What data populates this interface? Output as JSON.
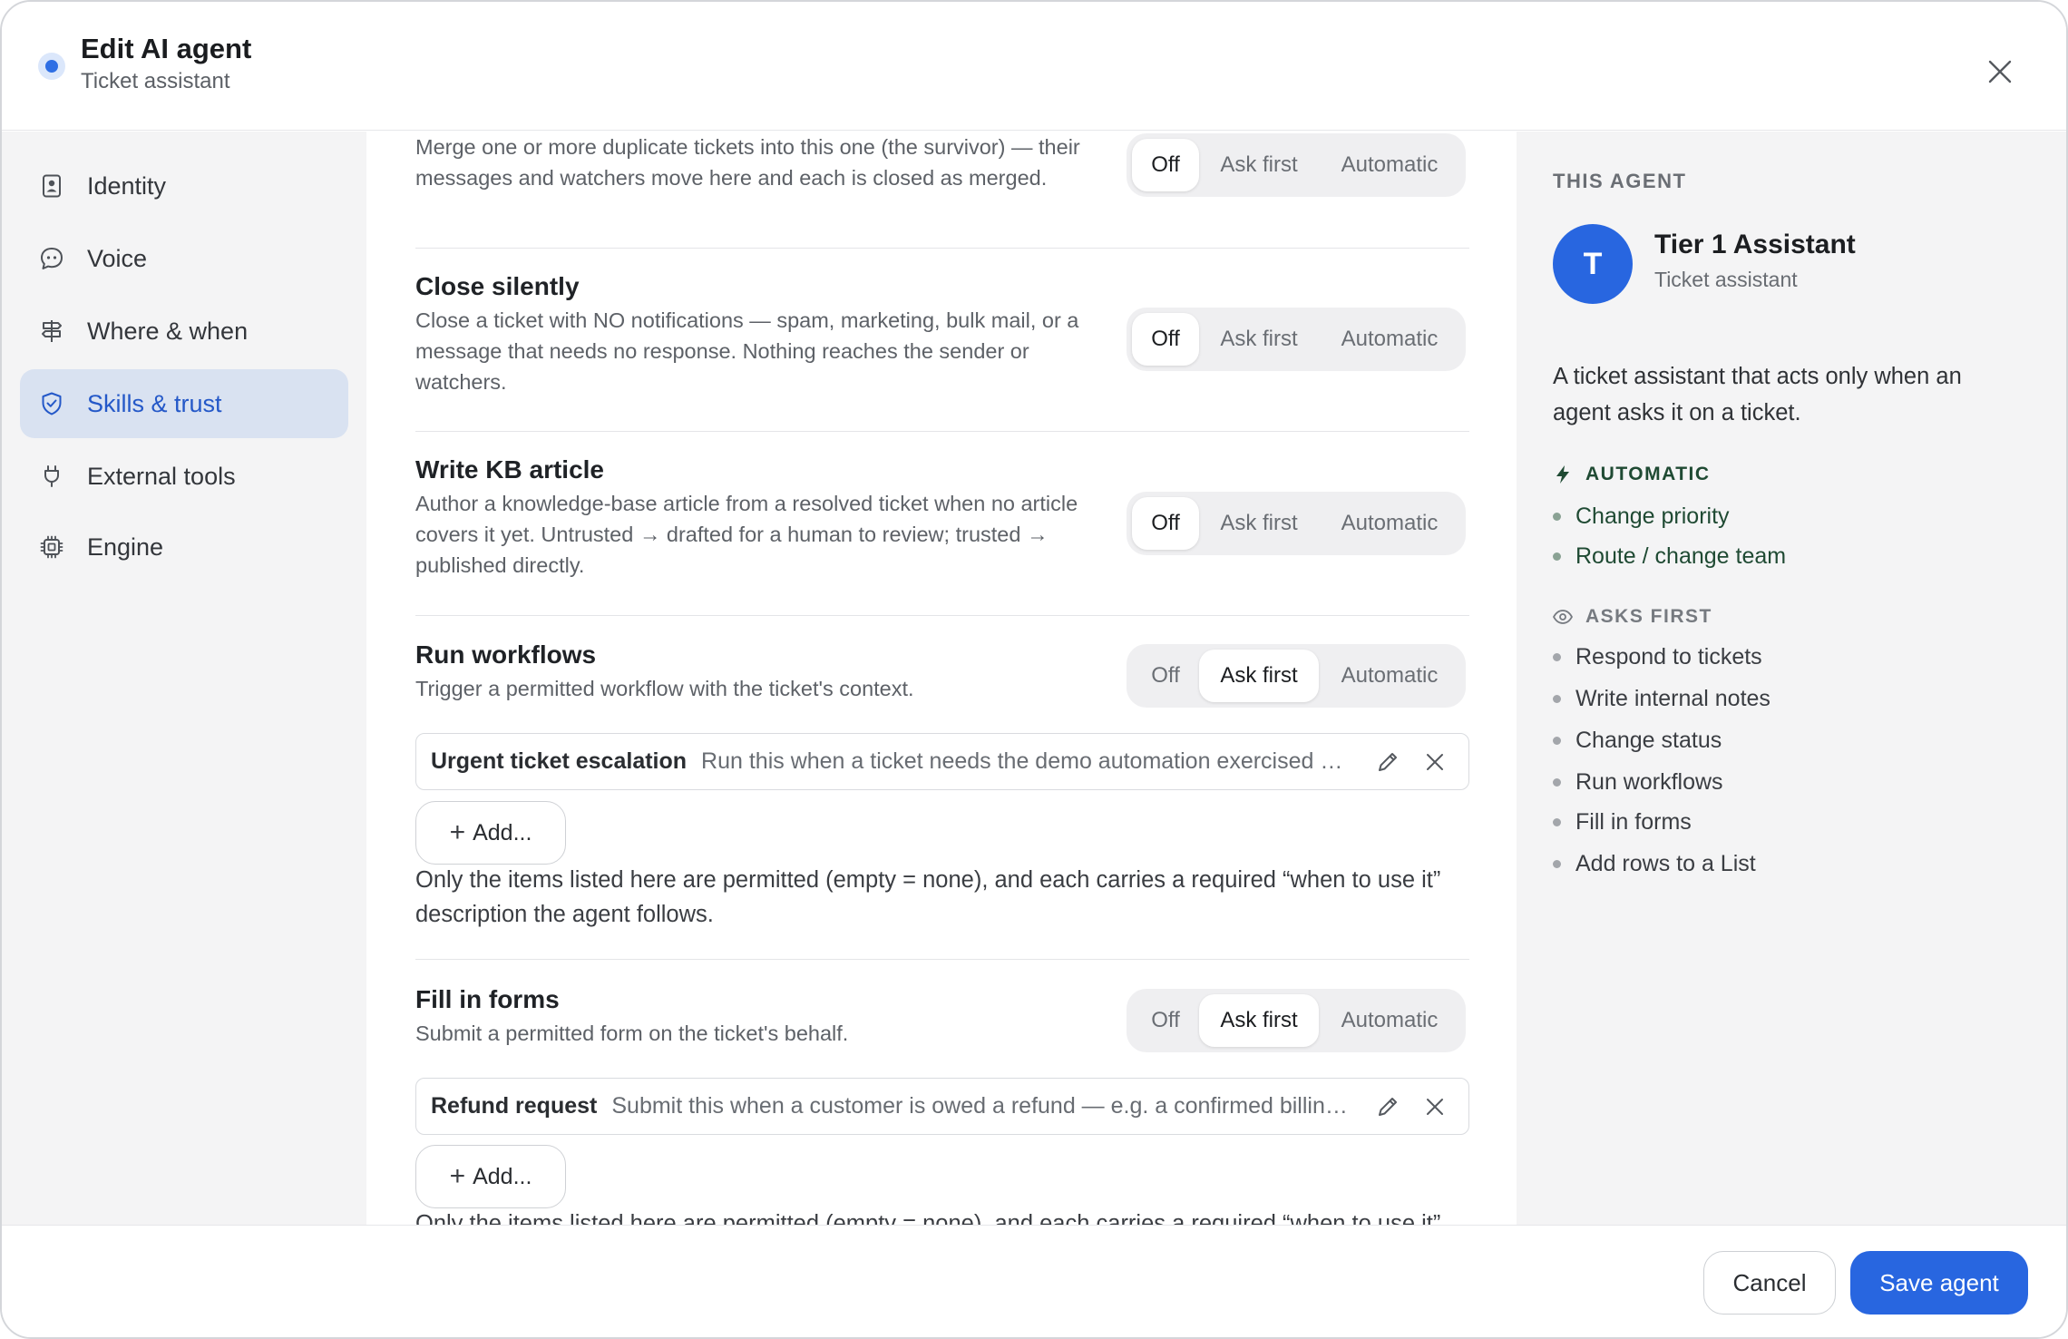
{
  "header": {
    "title": "Edit AI agent",
    "subtitle": "Ticket assistant"
  },
  "sidebar": {
    "items": [
      {
        "label": "Identity",
        "icon": "id-badge-icon"
      },
      {
        "label": "Voice",
        "icon": "speech-bubble-icon"
      },
      {
        "label": "Where & when",
        "icon": "signpost-icon"
      },
      {
        "label": "Skills & trust",
        "icon": "shield-check-icon",
        "active": true
      },
      {
        "label": "External tools",
        "icon": "plug-icon"
      },
      {
        "label": "Engine",
        "icon": "chip-icon"
      }
    ]
  },
  "segment_labels": {
    "off": "Off",
    "ask": "Ask first",
    "auto": "Automatic"
  },
  "skills": {
    "merge": {
      "desc": "Merge one or more duplicate tickets into this one (the survivor) — their messages and watchers move here and each is closed as merged.",
      "selected": "off"
    },
    "close": {
      "title": "Close silently",
      "desc": "Close a ticket with NO notifications — spam, marketing, bulk mail, or a message that needs no response. Nothing reaches the sender or watchers.",
      "selected": "off"
    },
    "kb": {
      "title": "Write KB article",
      "desc": "Author a knowledge-base article from a resolved ticket when no article covers it yet. Untrusted → drafted for a human to review; trusted → published directly.",
      "selected": "off"
    },
    "workflows": {
      "title": "Run workflows",
      "desc": "Trigger a permitted workflow with the ticket's context.",
      "selected": "ask",
      "item": {
        "name": "Urgent ticket escalation",
        "desc": "Run this when a ticket needs the demo automation exercised end to end"
      },
      "add_label": "Add...",
      "note": "Only the items listed here are permitted (empty = none), and each carries a required “when to use it” description the agent follows."
    },
    "forms": {
      "title": "Fill in forms",
      "desc": "Submit a permitted form on the ticket's behalf.",
      "selected": "ask",
      "item": {
        "name": "Refund request",
        "desc": "Submit this when a customer is owed a refund — e.g. a confirmed billing error"
      },
      "add_label": "Add...",
      "note": "Only the items listed here are permitted (empty = none), and each carries a required “when to use it” description the agent follows."
    }
  },
  "agent_panel": {
    "heading": "THIS AGENT",
    "avatar_letter": "T",
    "name": "Tier 1 Assistant",
    "role": "Ticket assistant",
    "description": "A ticket assistant that acts only when an agent asks it on a ticket.",
    "automatic_heading": "AUTOMATIC",
    "automatic_items": [
      "Change priority",
      "Route / change team"
    ],
    "ask_heading": "ASKS FIRST",
    "ask_items": [
      "Respond to tickets",
      "Write internal notes",
      "Change status",
      "Run workflows",
      "Fill in forms",
      "Add rows to a List"
    ]
  },
  "footer": {
    "cancel_label": "Cancel",
    "save_label": "Save agent"
  },
  "colors": {
    "accent": "#2866e0",
    "active_nav_bg": "#d9e2f1",
    "automatic_text": "#1f4a33"
  }
}
